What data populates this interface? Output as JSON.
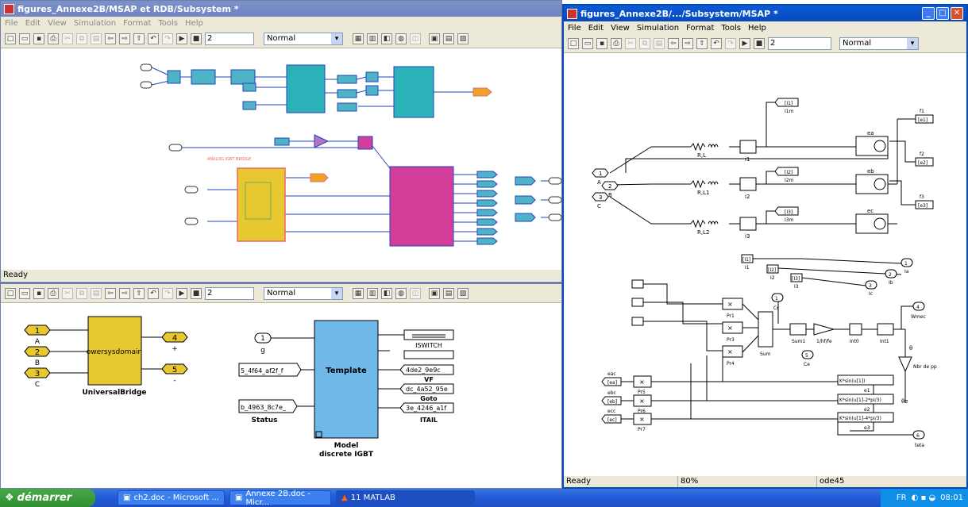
{
  "left_window": {
    "title": "figures_Annexe2B/MSAP et RDB/Subsystem *",
    "menu": [
      "File",
      "Edit",
      "View",
      "Simulation",
      "Format",
      "Tools",
      "Help"
    ],
    "stop_time": "2",
    "mode": "Normal",
    "status": "Ready"
  },
  "lower_window": {
    "stop_time": "2",
    "mode": "Normal",
    "ports_in": [
      {
        "num": "1",
        "name": "A"
      },
      {
        "num": "2",
        "name": "B"
      },
      {
        "num": "3",
        "name": "C"
      }
    ],
    "ports_out": [
      {
        "num": "4",
        "name": "+"
      },
      {
        "num": "5",
        "name": "-"
      }
    ],
    "bridge_text": "owersysdomain",
    "bridge_label": "UniversalBridge",
    "inport_g": {
      "num": "1",
      "name": "g"
    },
    "template_text": "Template",
    "template_label": "Model\ndiscrete IGBT",
    "from_tags": [
      "5_4f64_af2f_f",
      "b_4963_8c7e_",
      "Status"
    ],
    "goto_tags": [
      "ISWITCH",
      "4de2_9e9c",
      "VF",
      "dc_4a52_95e",
      "Goto",
      "3e_4246_a1f",
      "ITAIL"
    ]
  },
  "right_window": {
    "title": "figures_Annexe2B/.../Subsystem/MSAP *",
    "menu": [
      "File",
      "Edit",
      "View",
      "Simulation",
      "Format",
      "Tools",
      "Help"
    ],
    "stop_time": "2",
    "mode": "Normal",
    "status": "Ready",
    "zoom": "80%",
    "solver": "ode45",
    "ports_in": [
      {
        "num": "1",
        "name": "A"
      },
      {
        "num": "2",
        "name": "B"
      },
      {
        "num": "3",
        "name": "C"
      }
    ],
    "rl": [
      "R,L",
      "R,L1",
      "R,L2"
    ],
    "meas": [
      "i1",
      "i2",
      "i3"
    ],
    "emf": [
      "ea",
      "eb",
      "ec"
    ],
    "goto_top": [
      "[I1]",
      "[I2]",
      "[I3]"
    ],
    "goto_top_lbl": [
      "I1m",
      "I2m",
      "I3m"
    ],
    "emf_from": [
      "[e1]",
      "[e2]",
      "[e3]"
    ],
    "emf_lbl": [
      "f1",
      "f2",
      "f3"
    ],
    "outports": [
      {
        "num": "1",
        "name": "Ia"
      },
      {
        "num": "2",
        "name": "Ib"
      },
      {
        "num": "3",
        "name": "Ic"
      }
    ],
    "from_i": [
      "[I1]",
      "[I2]",
      "[I3]"
    ],
    "from_i_lbl": [
      "I1",
      "I2",
      "I3"
    ],
    "prods": [
      "Pr1",
      "Pr3",
      "Pr4",
      "Pr5",
      "Pr6",
      "Pr7"
    ],
    "sums": [
      "Sum",
      "Sum1"
    ],
    "gain": "1/hf/fe",
    "integs": [
      "Int0",
      "Int1"
    ],
    "wmec": {
      "num": "4",
      "name": "Wmec"
    },
    "ce": {
      "num": "5",
      "name": "Ce"
    },
    "cr": {
      "num": "1",
      "name": "Cr"
    },
    "theta": {
      "num": "6",
      "name": "teta"
    },
    "theta_lbl": "θ",
    "pgain": "Nbr de pp",
    "thetae": "θe",
    "fcn": [
      "K*sin(u[1])",
      "K*sin(u[1]-2*pi/3)",
      "K*sin(u[1]-4*pi/3)"
    ],
    "fcn_lbl": [
      "e1",
      "e2",
      "e3"
    ],
    "gotos_e": [
      "[ea]",
      "[eb]",
      "[ec]"
    ],
    "gotos_e_lbl": [
      "eac",
      "ebc",
      "ecc"
    ]
  },
  "taskbar": {
    "start": "démarrer",
    "items": [
      "ch2.doc - Microsoft ...",
      "Annexe 2B.doc - Micr...",
      "11 MATLAB"
    ],
    "lang": "FR",
    "time": "08:01"
  }
}
